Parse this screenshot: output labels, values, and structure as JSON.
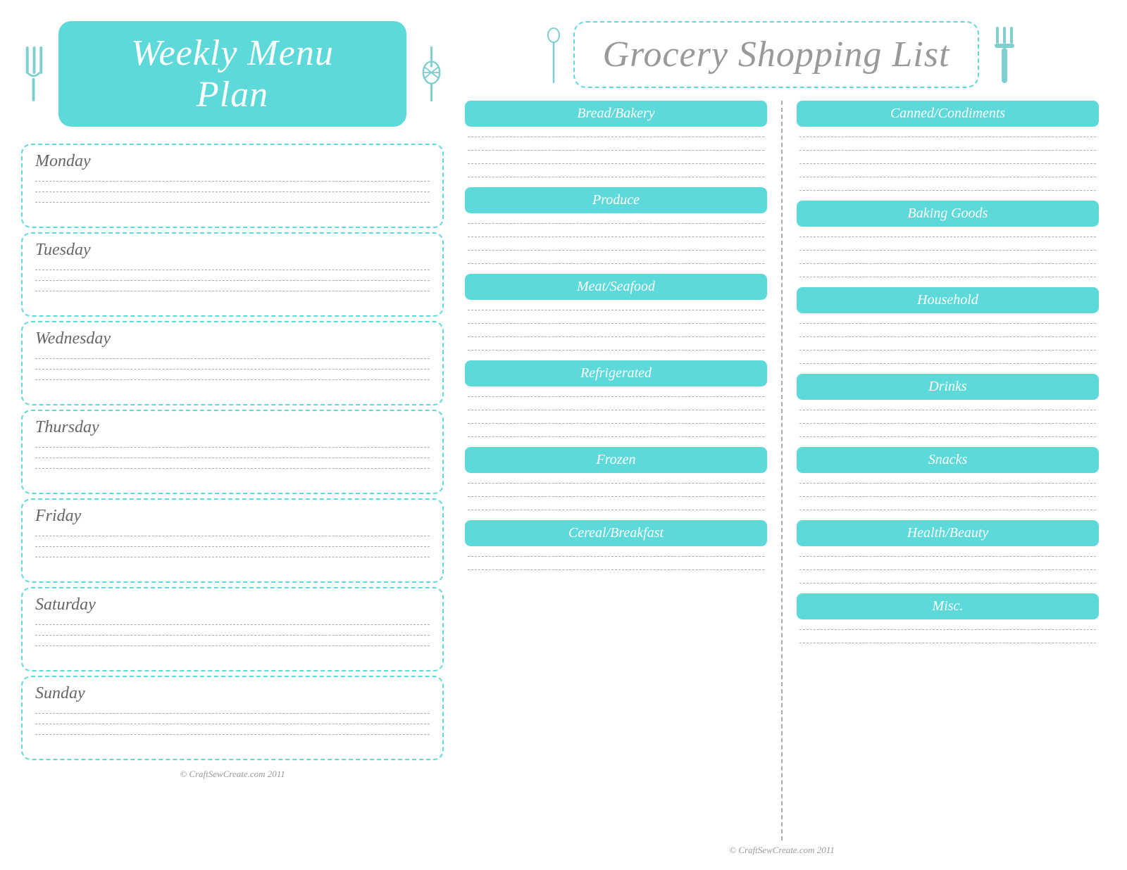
{
  "leftPanel": {
    "title": "Weekly Menu Plan",
    "footer": "© CraftSewCreate.com 2011",
    "days": [
      {
        "name": "Monday",
        "lines": 3
      },
      {
        "name": "Tuesday",
        "lines": 3
      },
      {
        "name": "Wednesday",
        "lines": 3
      },
      {
        "name": "Thursday",
        "lines": 3
      },
      {
        "name": "Friday",
        "lines": 3
      },
      {
        "name": "Saturday",
        "lines": 3
      },
      {
        "name": "Sunday",
        "lines": 3
      }
    ]
  },
  "rightPanel": {
    "title": "Grocery Shopping List",
    "footer": "© CraftSewCreate.com 2011",
    "leftCategories": [
      {
        "name": "Bread/Bakery",
        "lines": 4
      },
      {
        "name": "Produce",
        "lines": 4
      },
      {
        "name": "Meat/Seafood",
        "lines": 4
      },
      {
        "name": "Refrigerated",
        "lines": 4
      },
      {
        "name": "Frozen",
        "lines": 3
      },
      {
        "name": "Cereal/Breakfast",
        "lines": 2
      }
    ],
    "rightCategories": [
      {
        "name": "Canned/Condiments",
        "lines": 5
      },
      {
        "name": "Baking Goods",
        "lines": 4
      },
      {
        "name": "Household",
        "lines": 4
      },
      {
        "name": "Drinks",
        "lines": 3
      },
      {
        "name": "Snacks",
        "lines": 3
      },
      {
        "name": "Health/Beauty",
        "lines": 3
      },
      {
        "name": "Misc.",
        "lines": 2
      }
    ]
  },
  "icons": {
    "fork": "🍴",
    "whisk": "⚙",
    "spoon": "🥄",
    "spatula": "⚙"
  },
  "colors": {
    "teal": "#5dd9d9",
    "tealLight": "#7ecfcf",
    "gray": "#999",
    "dashed": "#aaa"
  }
}
